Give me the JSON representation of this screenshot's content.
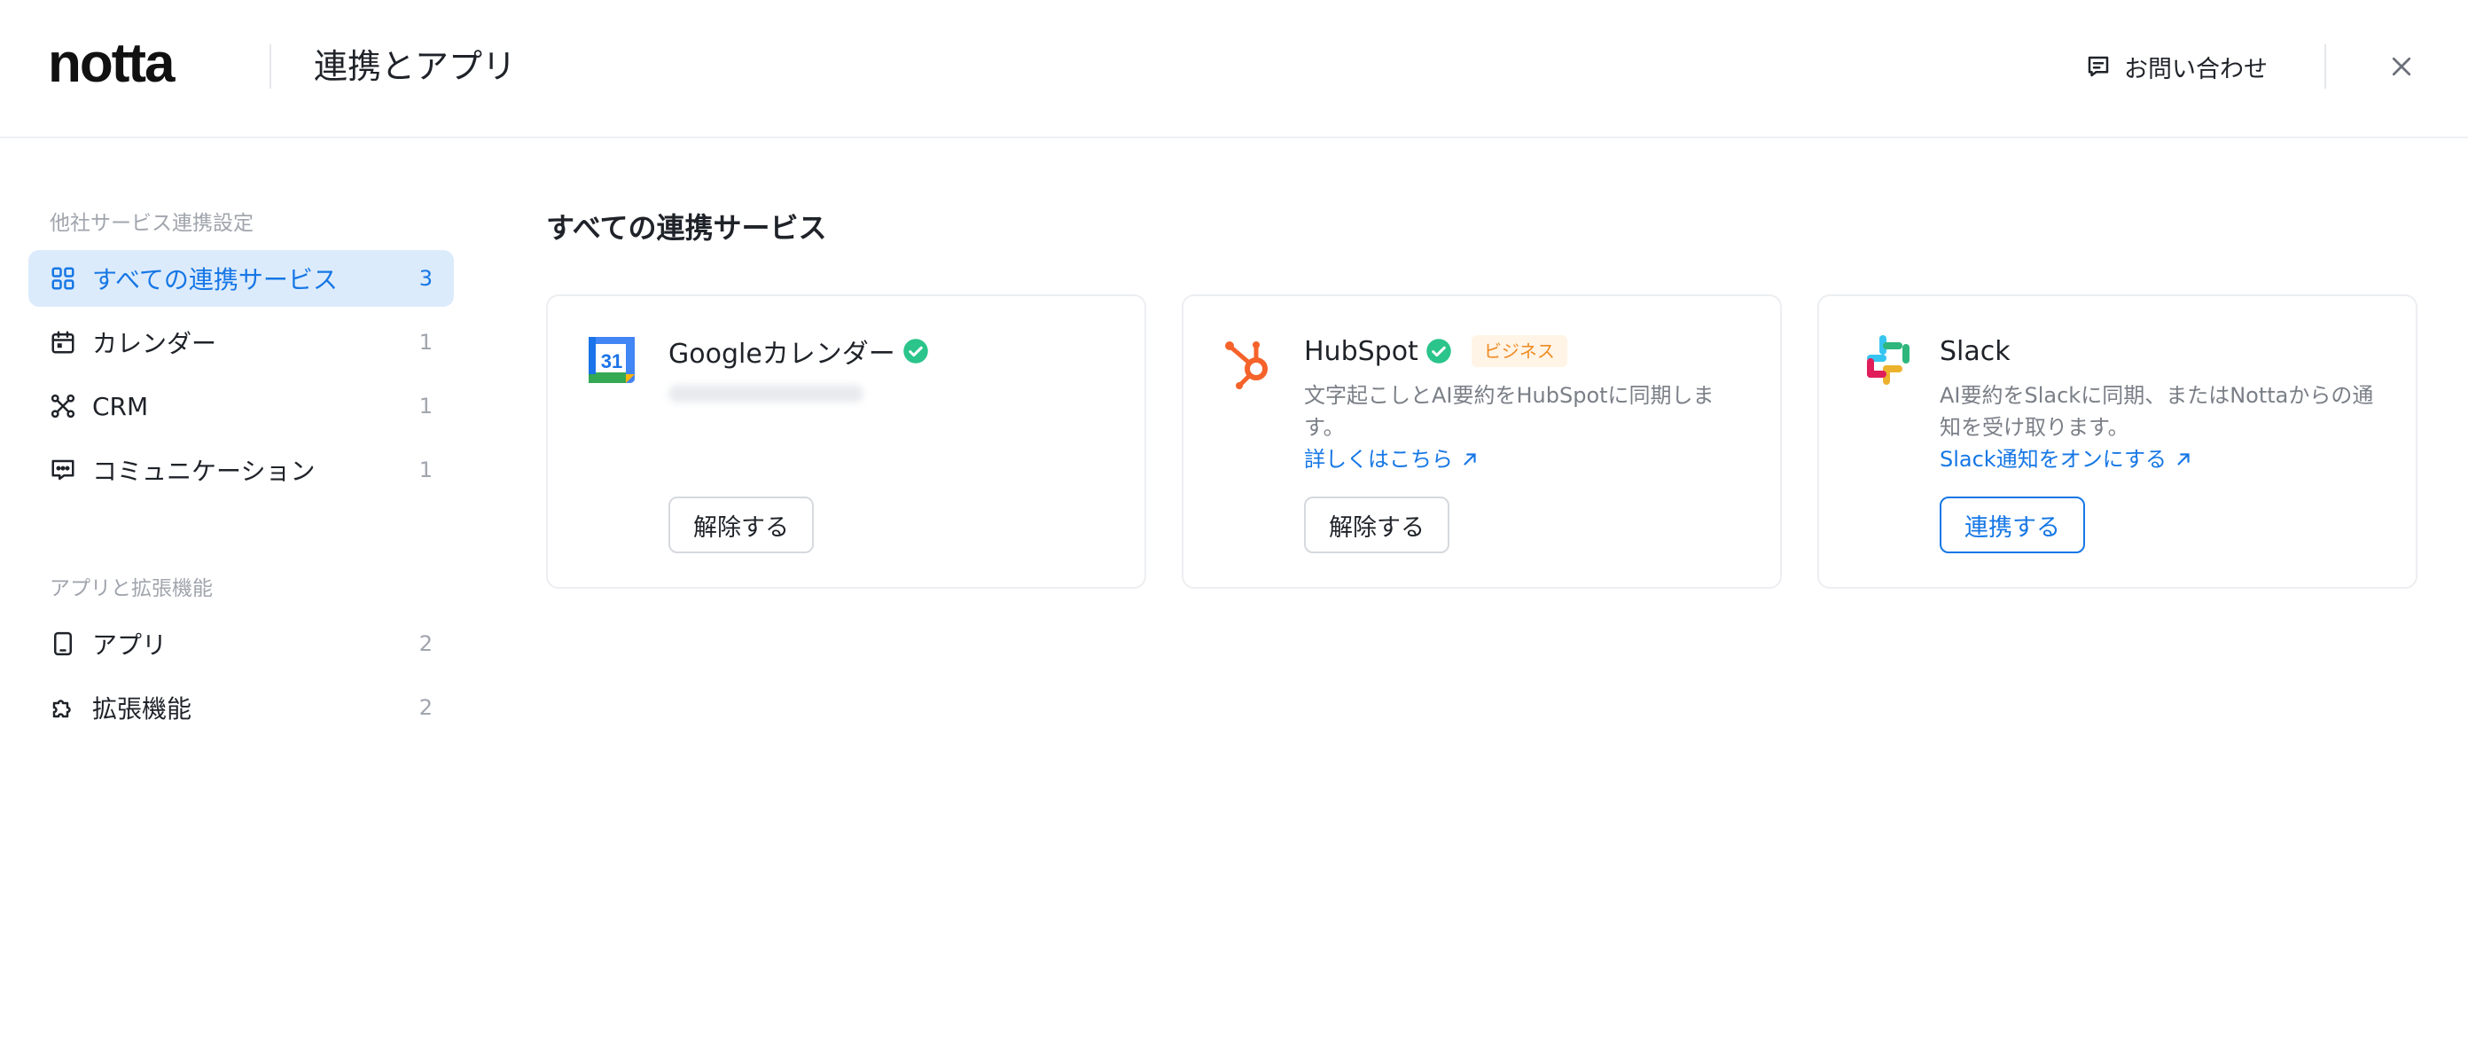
{
  "header": {
    "logo_text": "notta",
    "title": "連携とアプリ",
    "contact_label": "お問い合わせ"
  },
  "sidebar": {
    "section1_label": "他社サービス連携設定",
    "items1": [
      {
        "label": "すべての連携サービス",
        "count": "3",
        "icon": "grid-icon",
        "active": true
      },
      {
        "label": "カレンダー",
        "count": "1",
        "icon": "calendar-icon"
      },
      {
        "label": "CRM",
        "count": "1",
        "icon": "network-icon"
      },
      {
        "label": "コミュニケーション",
        "count": "1",
        "icon": "chat-icon"
      }
    ],
    "section2_label": "アプリと拡張機能",
    "items2": [
      {
        "label": "アプリ",
        "count": "2",
        "icon": "tablet-icon"
      },
      {
        "label": "拡張機能",
        "count": "2",
        "icon": "puzzle-icon"
      }
    ]
  },
  "main": {
    "title": "すべての連携サービス",
    "cards": [
      {
        "name": "Googleカレンダー",
        "icon": "google-calendar-logo",
        "connected": true,
        "calendar_day": "31",
        "button": "解除する"
      },
      {
        "name": "HubSpot",
        "icon": "hubspot-logo",
        "connected": true,
        "badge": "ビジネス",
        "desc": "文字起こしとAI要約をHubSpotに同期します。",
        "link": "詳しくはこちら",
        "button": "解除する"
      },
      {
        "name": "Slack",
        "icon": "slack-logo",
        "connected": false,
        "desc": "AI要約をSlackに同期、またはNottaからの通知を受け取ります。",
        "link": "Slack通知をオンにする",
        "button": "連携する"
      }
    ]
  },
  "colors": {
    "accent": "#1677e5",
    "active_bg": "#dcebfc",
    "verified": "#2bc48a",
    "hubspot": "#f5632a",
    "badge_text": "#f08a24"
  }
}
